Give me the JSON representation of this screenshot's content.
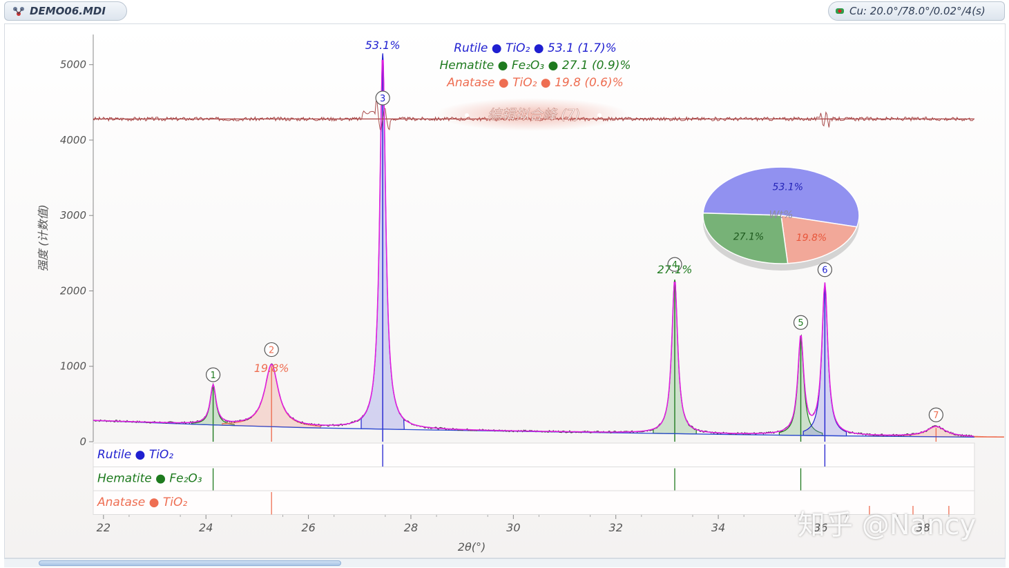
{
  "window": {
    "doc_title": "DEMO06.MDI",
    "status_text": "Cu: 20.0°/78.0°/0.02°/4(s)",
    "doc_icon": "molecule-icon",
    "status_icon": "xray-tube-icon"
  },
  "overlay_label": "编辑拟合峰 (7)",
  "watermark": "知乎 @Nancy",
  "legend": [
    {
      "name": "Rutile",
      "formula": "TiO₂",
      "pct": "53.1 (1.7)%",
      "color": "#1f1fd0"
    },
    {
      "name": "Hematite",
      "formula": "Fe₂O₃",
      "pct": "27.1 (0.9)%",
      "color": "#1e7a1e"
    },
    {
      "name": "Anatase",
      "formula": "TiO₂",
      "pct": "19.8 (0.6)%",
      "color": "#ee6e52"
    }
  ],
  "strips": [
    {
      "label": "Rutile",
      "formula": "TiO₂",
      "color": "#1f1fd0",
      "lines": [
        27.45,
        36.08
      ]
    },
    {
      "label": "Hematite",
      "formula": "Fe₂O₃",
      "color": "#1e7a1e",
      "lines": [
        24.14,
        33.15,
        35.61
      ]
    },
    {
      "label": "Anatase",
      "formula": "TiO₂",
      "color": "#ee6e52",
      "lines": [
        25.28,
        36.95,
        37.8,
        38.5
      ]
    }
  ],
  "peaks": [
    {
      "id": "1",
      "x": 24.14,
      "y": 740,
      "phase": 1
    },
    {
      "id": "2",
      "x": 25.28,
      "y": 1020,
      "phase": 2
    },
    {
      "id": "3",
      "x": 27.45,
      "y": 5150,
      "phase": 0
    },
    {
      "id": "4",
      "x": 33.15,
      "y": 2150,
      "phase": 1
    },
    {
      "id": "5",
      "x": 35.61,
      "y": 1380,
      "phase": 1
    },
    {
      "id": "6",
      "x": 36.08,
      "y": 2080,
      "phase": 0
    },
    {
      "id": "7",
      "x": 38.25,
      "y": 200,
      "phase": 2
    }
  ],
  "peak_labels": [
    {
      "text": "53.1%",
      "x": 27.45,
      "color": "#1f1fd0"
    },
    {
      "text": "19.8%",
      "x": 25.28,
      "color": "#ee6e52"
    },
    {
      "text": "27.1%",
      "x": 33.15,
      "color": "#1e7a1e"
    }
  ],
  "pie": {
    "center_label": "Wt%",
    "slices": [
      {
        "label": "53.1%",
        "value": 53.1,
        "color": "#9191f0",
        "text_color": "#2424b8"
      },
      {
        "label": "19.8%",
        "value": 19.8,
        "color": "#f2a899",
        "text_color": "#e8573c"
      },
      {
        "label": "27.1%",
        "value": 27.1,
        "color": "#77b277",
        "text_color": "#1e5a1e"
      }
    ]
  },
  "chart_data": {
    "type": "line",
    "xlabel": "2θ(°)",
    "ylabel": "强度 (计数值)",
    "xlim": [
      21.8,
      39.0
    ],
    "ylim": [
      0,
      5400
    ],
    "xticks": [
      22,
      24,
      26,
      28,
      30,
      32,
      34,
      36,
      38
    ],
    "yticks": [
      0,
      1000,
      2000,
      3000,
      4000,
      5000
    ],
    "grid": false,
    "difference_offset": 4280,
    "background": [
      [
        21.8,
        280
      ],
      [
        24,
        225
      ],
      [
        26,
        185
      ],
      [
        28,
        160
      ],
      [
        30,
        138
      ],
      [
        32,
        118
      ],
      [
        34,
        98
      ],
      [
        36,
        80
      ],
      [
        39,
        60
      ]
    ],
    "series": [
      {
        "name": "Rutile",
        "values": [
          [
            27.45,
            5150
          ],
          [
            36.08,
            2080
          ]
        ]
      },
      {
        "name": "Hematite",
        "values": [
          [
            24.14,
            740
          ],
          [
            33.15,
            2150
          ],
          [
            35.61,
            1380
          ]
        ]
      },
      {
        "name": "Anatase",
        "values": [
          [
            25.28,
            1020
          ],
          [
            38.25,
            200
          ]
        ]
      }
    ]
  }
}
